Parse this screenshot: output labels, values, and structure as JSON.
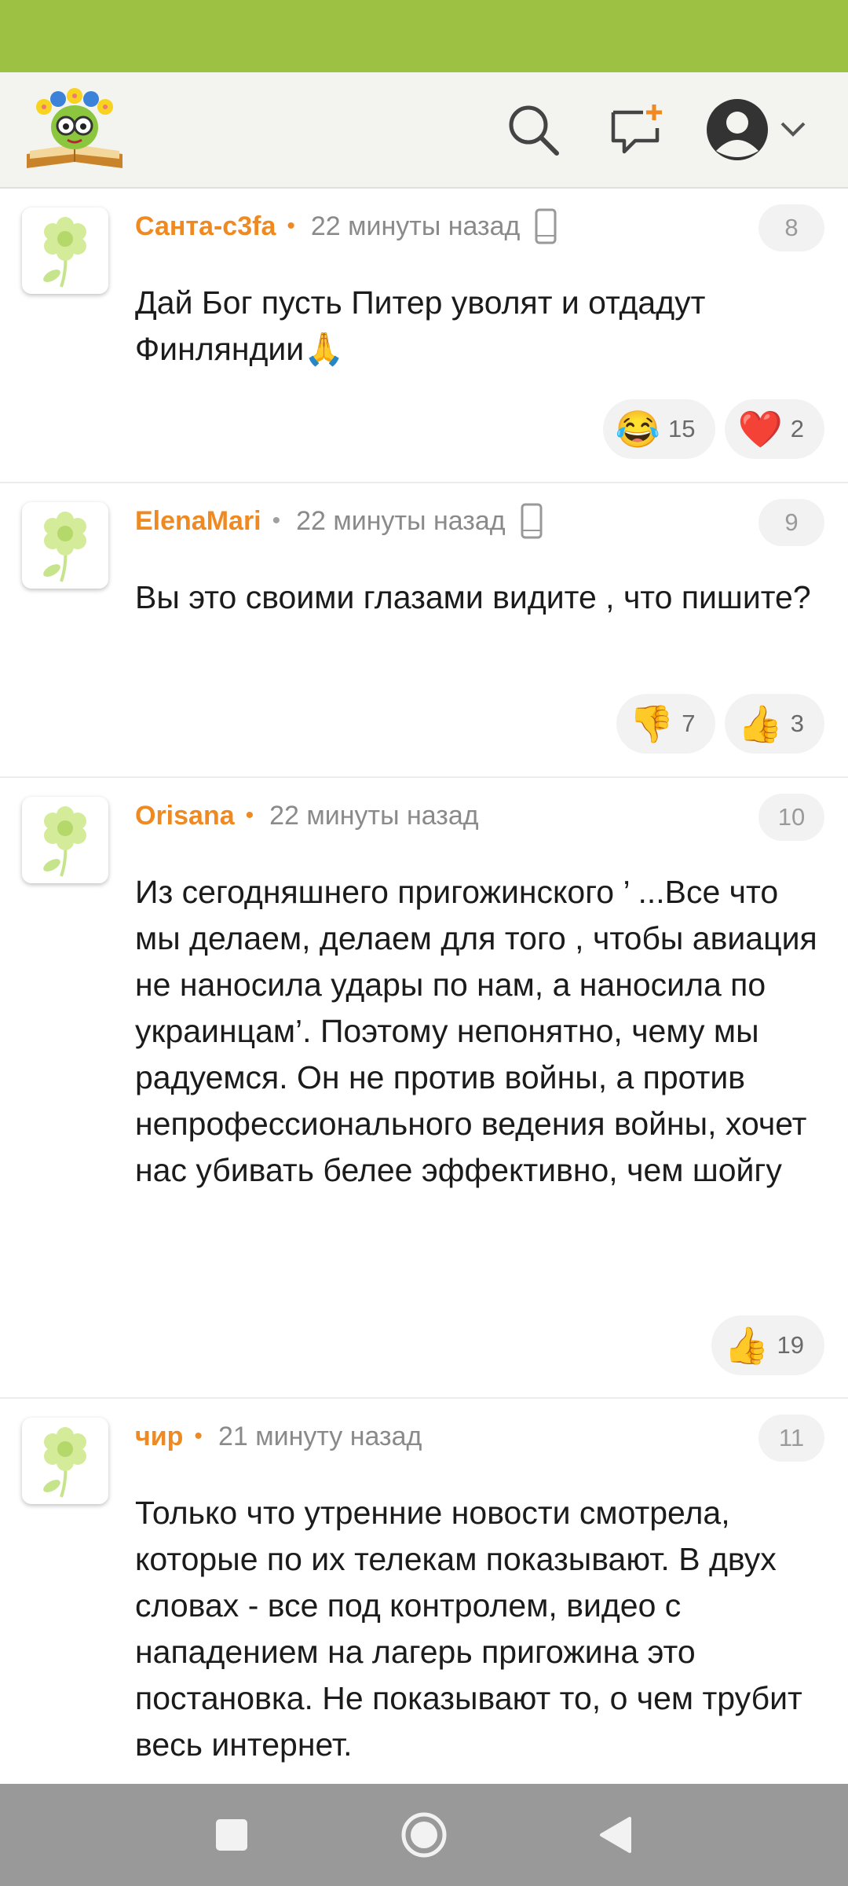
{
  "colors": {
    "status_bar": "#9dc143",
    "author": "#ef8a22",
    "nav_bar": "#999999"
  },
  "header": {
    "logo": "flower-book-logo",
    "icons": [
      "search-icon",
      "new-message-icon",
      "avatar-icon",
      "chevron-down-icon"
    ]
  },
  "comments": [
    {
      "author": "Санта-с3fa",
      "time": "22 минуты назад",
      "mobile": true,
      "number": "8",
      "text": "Дай Бог пусть Питер уволят и отдадут Финляндии🙏",
      "reactions": [
        {
          "emoji": "😂",
          "icon": "laughing-emoji-icon",
          "count": "15"
        },
        {
          "emoji": "❤️",
          "icon": "heart-emoji-icon",
          "count": "2"
        }
      ]
    },
    {
      "author": "ElenaMari",
      "time": "22 минуты назад",
      "mobile": true,
      "number": "9",
      "text": "Вы это своими глазами видите , что пишите?",
      "reactions": [
        {
          "emoji": "👎",
          "icon": "thumbs-down-icon",
          "count": "7"
        },
        {
          "emoji": "👍",
          "icon": "thumbs-up-icon",
          "count": "3"
        }
      ]
    },
    {
      "author": "Orisana",
      "time": "22 минуты назад",
      "mobile": false,
      "number": "10",
      "text": "Из сегодняшнего пригожинского ’ ...Все что мы делаем, делаем для того , чтобы авиация не наносила удары по нам, а наносила по украинцам’. Поэтому непонятно, чему мы радуемся. Он не против войны, а против непрофессионального ведения войны, хочет нас убивать белее эффективно, чем шойгу",
      "reactions": [
        {
          "emoji": "👍",
          "icon": "thumbs-up-icon",
          "count": "19"
        }
      ]
    },
    {
      "author": "чир",
      "time": "21 минуту назад",
      "mobile": false,
      "number": "11",
      "text": "Только что утренние новости смотрела, которые по их телекам показывают. В двух словах - все под контролем, видео с нападением на лагерь пригожина это постановка. Не показывают то, о чем трубит весь интернет.",
      "reactions": []
    }
  ],
  "nav": {
    "icons": [
      "square-recents-icon",
      "circle-home-icon",
      "triangle-back-icon"
    ]
  }
}
